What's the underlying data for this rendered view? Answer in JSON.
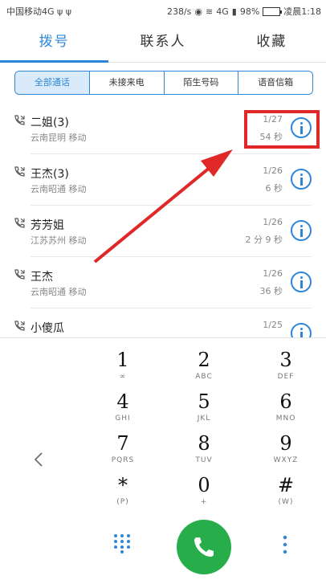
{
  "status_bar": {
    "carrier": "中国移动4G ψ ψ",
    "speed": "238/s",
    "signal": "4G",
    "battery": "98%",
    "time": "凌晨1:18"
  },
  "tabs": [
    {
      "label": "拨号",
      "active": true
    },
    {
      "label": "联系人",
      "active": false
    },
    {
      "label": "收藏",
      "active": false
    }
  ],
  "filters": [
    {
      "label": "全部通话",
      "active": true
    },
    {
      "label": "未接来电",
      "active": false
    },
    {
      "label": "陌生号码",
      "active": false
    },
    {
      "label": "语音信箱",
      "active": false
    }
  ],
  "calls": [
    {
      "name": "二姐(3)",
      "location": "云南昆明 移动",
      "date": "1/27",
      "duration": "54 秒"
    },
    {
      "name": "王杰(3)",
      "location": "云南昭通 移动",
      "date": "1/26",
      "duration": "6 秒"
    },
    {
      "name": "芳芳姐",
      "location": "江苏苏州 移动",
      "date": "1/26",
      "duration": "2 分 9 秒"
    },
    {
      "name": "王杰",
      "location": "云南昭通 移动",
      "date": "1/26",
      "duration": "36 秒"
    },
    {
      "name": "小傻瓜",
      "location": "",
      "date": "1/25",
      "duration": ""
    }
  ],
  "keys": [
    {
      "num": "1",
      "sub": "∞"
    },
    {
      "num": "2",
      "sub": "ABC"
    },
    {
      "num": "3",
      "sub": "DEF"
    },
    {
      "num": "4",
      "sub": "GHI"
    },
    {
      "num": "5",
      "sub": "JKL"
    },
    {
      "num": "6",
      "sub": "MNO"
    },
    {
      "num": "7",
      "sub": "PQRS"
    },
    {
      "num": "8",
      "sub": "TUV"
    },
    {
      "num": "9",
      "sub": "WXYZ"
    },
    {
      "num": "*",
      "sub": "(P)"
    },
    {
      "num": "0",
      "sub": "+"
    },
    {
      "num": "#",
      "sub": "(W)"
    }
  ],
  "colors": {
    "accent": "#2f86d6",
    "call_green": "#27ae4b",
    "annotation_red": "#e02828"
  },
  "icons": {
    "back": "chevron-left-icon",
    "dialpad_toggle": "dialpad-grid-icon",
    "call": "phone-icon",
    "more": "more-vertical-icon",
    "info": "info-icon"
  }
}
